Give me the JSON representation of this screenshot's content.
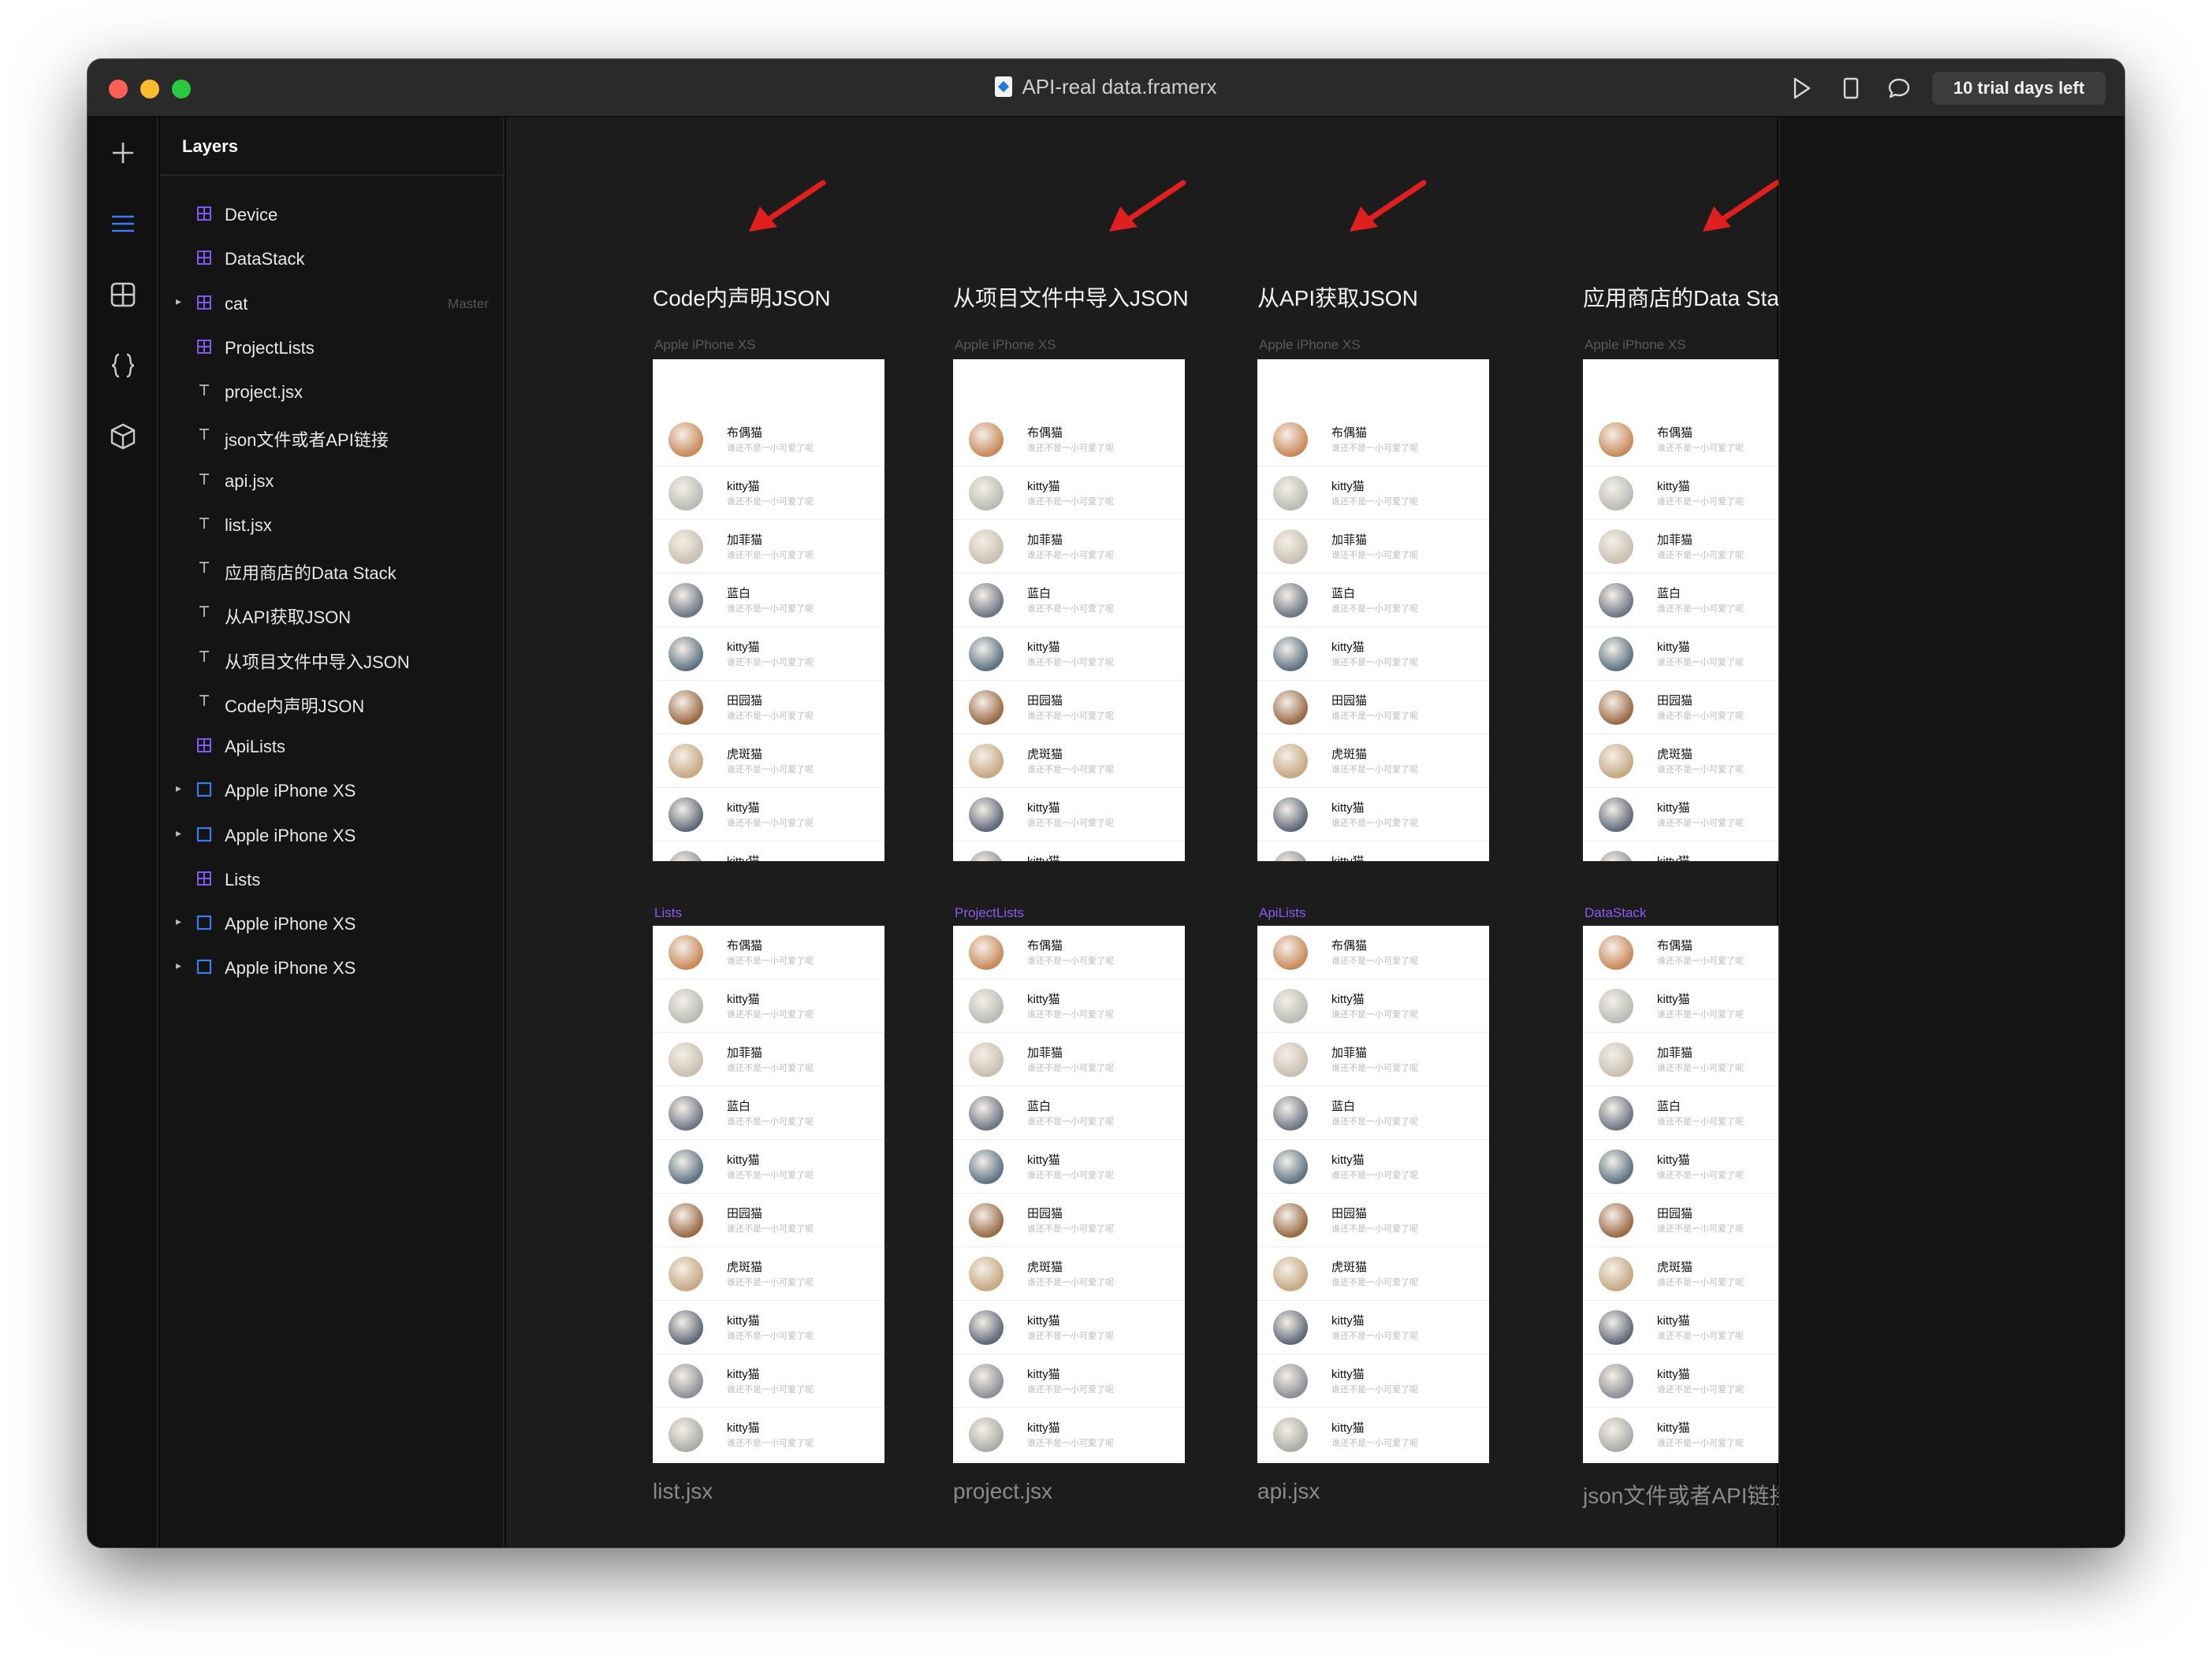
{
  "window": {
    "title": "API-real data.framerx",
    "trial_badge": "10 trial days left",
    "toolbar_icons": [
      "play-icon",
      "device-icon",
      "comment-icon"
    ]
  },
  "tools": [
    "plus-icon",
    "layers-icon",
    "components-icon",
    "code-icon",
    "package-icon"
  ],
  "layers": {
    "title": "Layers",
    "items": [
      {
        "label": "Device",
        "icon": "grid",
        "expand": false,
        "tag": ""
      },
      {
        "label": "DataStack",
        "icon": "grid",
        "expand": false,
        "tag": ""
      },
      {
        "label": "cat",
        "icon": "grid",
        "expand": true,
        "tag": "Master"
      },
      {
        "label": "ProjectLists",
        "icon": "grid",
        "expand": false,
        "tag": ""
      },
      {
        "label": "project.jsx",
        "icon": "text",
        "expand": false,
        "tag": ""
      },
      {
        "label": "json文件或者API链接",
        "icon": "text",
        "expand": false,
        "tag": ""
      },
      {
        "label": "api.jsx",
        "icon": "text",
        "expand": false,
        "tag": ""
      },
      {
        "label": "list.jsx",
        "icon": "text",
        "expand": false,
        "tag": ""
      },
      {
        "label": "应用商店的Data Stack",
        "icon": "text",
        "expand": false,
        "tag": ""
      },
      {
        "label": "从API获取JSON",
        "icon": "text",
        "expand": false,
        "tag": ""
      },
      {
        "label": "从项目文件中导入JSON",
        "icon": "text",
        "expand": false,
        "tag": ""
      },
      {
        "label": "Code内声明JSON",
        "icon": "text",
        "expand": false,
        "tag": ""
      },
      {
        "label": "ApiLists",
        "icon": "grid",
        "expand": false,
        "tag": ""
      },
      {
        "label": "Apple iPhone XS",
        "icon": "frame",
        "expand": true,
        "tag": ""
      },
      {
        "label": "Apple iPhone XS",
        "icon": "frame",
        "expand": true,
        "tag": ""
      },
      {
        "label": "Lists",
        "icon": "grid",
        "expand": false,
        "tag": ""
      },
      {
        "label": "Apple iPhone XS",
        "icon": "frame",
        "expand": true,
        "tag": ""
      },
      {
        "label": "Apple iPhone XS",
        "icon": "frame",
        "expand": true,
        "tag": ""
      }
    ]
  },
  "columns": [
    {
      "heading": "Code内声明JSON",
      "top_label": "Apple iPhone XS",
      "bottom_label": "Lists",
      "footer": "list.jsx"
    },
    {
      "heading": "从项目文件中导入JSON",
      "top_label": "Apple iPhone XS",
      "bottom_label": "ProjectLists",
      "footer": "project.jsx"
    },
    {
      "heading": "从API获取JSON",
      "top_label": "Apple iPhone XS",
      "bottom_label": "ApiLists",
      "footer": "api.jsx"
    },
    {
      "heading": "应用商店的Data Stack",
      "top_label": "Apple iPhone XS",
      "bottom_label": "DataStack",
      "footer": "json文件或者API链接"
    }
  ],
  "cats": [
    {
      "name": "布偶猫",
      "desc": "谁还不是一小可爱了呢",
      "color": "#c9895a"
    },
    {
      "name": "kitty猫",
      "desc": "谁还不是一小可爱了呢",
      "color": "#b8bcb5"
    },
    {
      "name": "加菲猫",
      "desc": "谁还不是一小可爱了呢",
      "color": "#c7c0b2"
    },
    {
      "name": "蓝白",
      "desc": "谁还不是一小可爱了呢",
      "color": "#6f7585"
    },
    {
      "name": "kitty猫",
      "desc": "谁还不是一小可爱了呢",
      "color": "#5d7284"
    },
    {
      "name": "田园猫",
      "desc": "谁还不是一小可爱了呢",
      "color": "#9a6a45"
    },
    {
      "name": "虎斑猫",
      "desc": "谁还不是一小可爱了呢",
      "color": "#c6a882"
    },
    {
      "name": "kitty猫",
      "desc": "谁还不是一小可爱了呢",
      "color": "#5f6878"
    },
    {
      "name": "kitty猫",
      "desc": "谁还不是一小可爱了呢",
      "color": "#8d8f97"
    },
    {
      "name": "kitty猫",
      "desc": "谁还不是一小可爱了呢",
      "color": "#a9aca6"
    }
  ],
  "colors": {
    "accent_purple": "#8a5cf5",
    "arrow_red": "#e0201e",
    "frame_blue": "#3d7bf3"
  }
}
